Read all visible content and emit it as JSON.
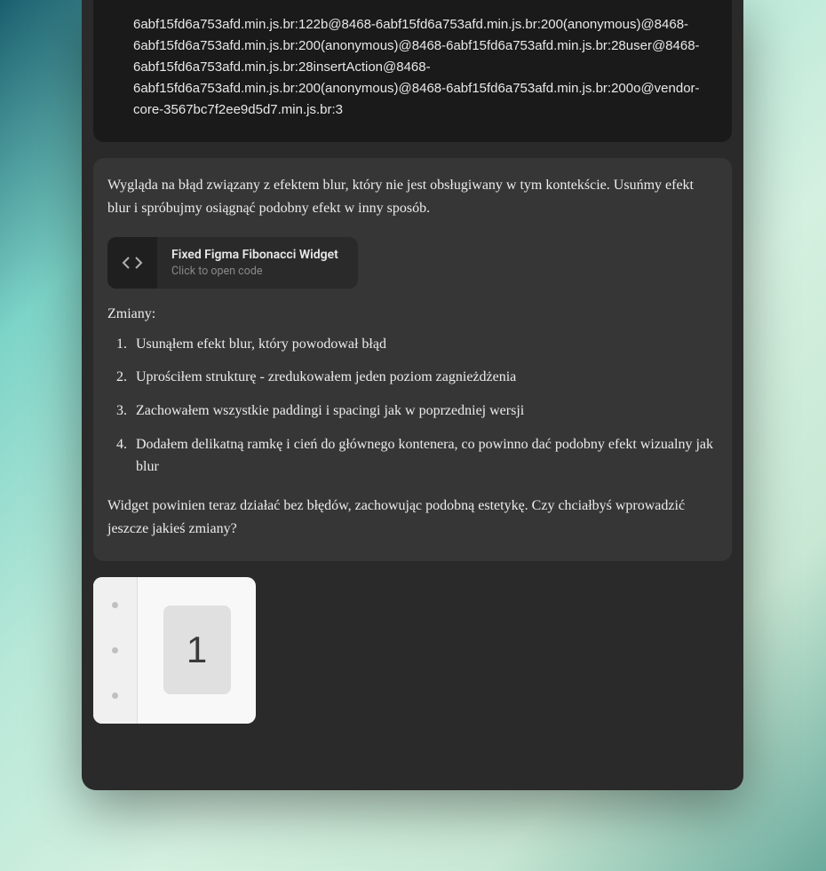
{
  "stack_trace": "6abf15fd6a753afd.min.js.br:122b@8468-6abf15fd6a753afd.min.js.br:200(anonymous)@8468-6abf15fd6a753afd.min.js.br:200(anonymous)@8468-6abf15fd6a753afd.min.js.br:28user@8468-6abf15fd6a753afd.min.js.br:28insertAction@8468-6abf15fd6a753afd.min.js.br:200(anonymous)@8468-6abf15fd6a753afd.min.js.br:200o@vendor-core-3567bc7f2ee9d5d7.min.js.br:3",
  "response": {
    "intro": "Wygląda na błąd związany z efektem blur, który nie jest obsługiwany w tym kontekście. Usuńmy efekt blur i spróbujmy osiągnąć podobny efekt w inny sposób.",
    "code_card": {
      "title": "Fixed Figma Fibonacci Widget",
      "subtitle": "Click to open code"
    },
    "changes_header": "Zmiany:",
    "changes": [
      "Usunąłem efekt blur, który powodował błąd",
      "Uprościłem strukturę - zredukowałem jeden poziom zagnieżdżenia",
      "Zachowałem wszystkie paddingi i spacingi jak w poprzedniej wersji",
      "Dodałem delikatną ramkę i cień do głównego kontenera, co powinno dać podobny efekt wizualny jak blur"
    ],
    "closing": "Widget powinien teraz działać bez błędów, zachowując podobną estetykę. Czy chciałbyś wprowadzić jeszcze jakieś zmiany?"
  },
  "attachment": {
    "number": "1"
  }
}
